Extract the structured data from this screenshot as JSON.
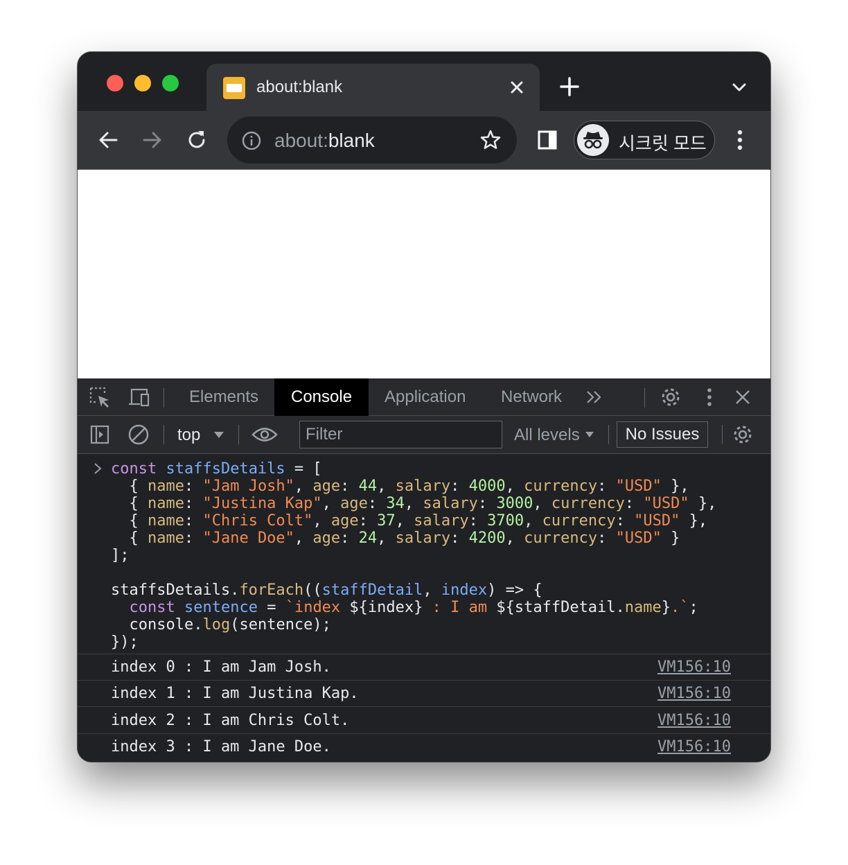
{
  "browser": {
    "tab": {
      "title": "about:blank"
    },
    "omnibox": {
      "scheme": "about:",
      "host": "blank"
    },
    "incognito_label": "시크릿 모드"
  },
  "devtools": {
    "tabs": [
      "Elements",
      "Console",
      "Application",
      "Network"
    ],
    "active_tab": "Console",
    "context": "top",
    "filter_placeholder": "Filter",
    "levels": "All levels",
    "issues": "No Issues"
  },
  "console": {
    "code": {
      "l1_kw": "const",
      "l1_var": "staffsDetails",
      "l1_rest": " = [",
      "rows": [
        {
          "name": "\"Jam Josh\"",
          "age": "44",
          "salary": "4000",
          "currency": "\"USD\"",
          "end": " },",
          "pad": ""
        },
        {
          "name": "\"Justina Kap\"",
          "age": "34",
          "salary": "3000",
          "currency": "\"USD\"",
          "end": " },",
          "pad": ""
        },
        {
          "name": "\"Chris Colt\"",
          "age": "37",
          "salary": "3700",
          "currency": "\"USD\"",
          "end": " },",
          "pad": ""
        },
        {
          "name": "\"Jane Doe\"",
          "age": "24",
          "salary": "4200",
          "currency": "\"USD\"",
          "end": " }",
          "pad": ""
        }
      ],
      "close": "];",
      "foreach_obj": "staffsDetails.",
      "foreach_fn": "forEach",
      "foreach_p1": "staffDetail",
      "foreach_p2": "index",
      "sentence_kw": "const",
      "sentence_var": "sentence",
      "tmpl_a": "`index ",
      "tmpl_b": "${index}",
      "tmpl_c": " : I am ",
      "tmpl_d": "${staffDetail.",
      "tmpl_e": "name",
      "tmpl_f": "}",
      "tmpl_g": ".`",
      "log_obj": "console.",
      "log_fn": "log",
      "log_arg": "(sentence);",
      "end": "});"
    },
    "logs": [
      {
        "text": "index 0 : I am Jam Josh.",
        "source": "VM156:10"
      },
      {
        "text": "index 1 : I am Justina Kap.",
        "source": "VM156:10"
      },
      {
        "text": "index 2 : I am Chris Colt.",
        "source": "VM156:10"
      },
      {
        "text": "index 3 : I am Jane Doe.",
        "source": "VM156:10"
      }
    ]
  },
  "colors": {
    "titlebar": "#202124",
    "toolbar": "#35363a",
    "devtools": "#202124",
    "accent_keyword": "#c792ea"
  }
}
